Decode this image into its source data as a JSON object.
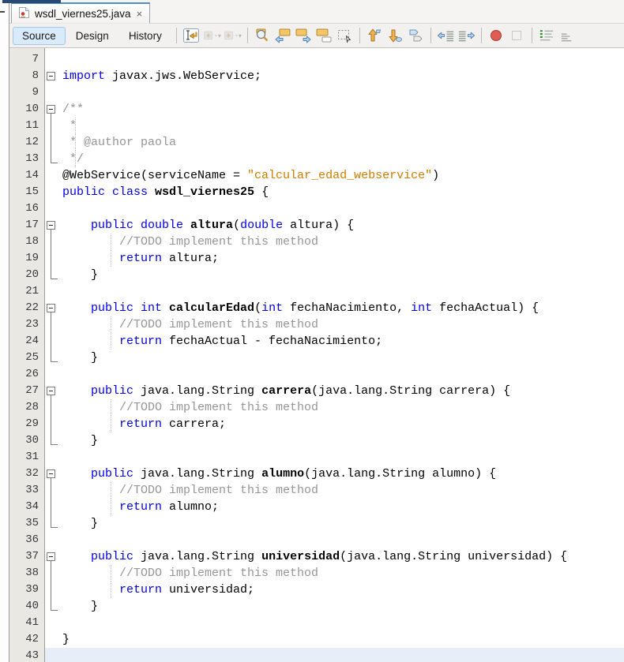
{
  "tab_bar": {
    "active_tab": {
      "label": "wsdl_viernes25.java",
      "close_label": "×",
      "icon": "java-file-icon"
    }
  },
  "toolbar": {
    "view_buttons": [
      {
        "label": "Source",
        "active": true
      },
      {
        "label": "Design",
        "active": false
      },
      {
        "label": "History",
        "active": false
      }
    ],
    "icon_groups": [
      [
        {
          "name": "last-edit-icon"
        },
        {
          "name": "back-icon",
          "disabled": true,
          "dropdown": true
        },
        {
          "name": "forward-icon",
          "disabled": true,
          "dropdown": true
        }
      ],
      [
        {
          "name": "find-selection-icon"
        },
        {
          "name": "find-previous-icon"
        },
        {
          "name": "find-next-icon"
        },
        {
          "name": "toggle-highlight-icon"
        },
        {
          "name": "rect-selection-icon"
        }
      ],
      [
        {
          "name": "previous-bookmark-icon"
        },
        {
          "name": "next-bookmark-icon"
        },
        {
          "name": "toggle-bookmark-icon"
        }
      ],
      [
        {
          "name": "shift-left-icon"
        },
        {
          "name": "shift-right-icon"
        }
      ],
      [
        {
          "name": "start-macro-icon"
        },
        {
          "name": "stop-macro-icon",
          "disabled": true
        }
      ],
      [
        {
          "name": "comment-icon"
        },
        {
          "name": "uncomment-icon"
        }
      ]
    ]
  },
  "editor": {
    "current_line": 43,
    "colors": {
      "keyword": "#0000e6",
      "string": "#ce7b00",
      "comment": "#969696",
      "plain": "#000000",
      "current_line_bg": "#e7eef8",
      "gutter_bg": "#e9e8e3"
    },
    "lines": [
      {
        "n": 7,
        "f": null,
        "g": null,
        "t": []
      },
      {
        "n": 8,
        "f": "single",
        "g": null,
        "t": [
          {
            "s": "k",
            "v": "import"
          },
          {
            "s": "p",
            "v": " javax.jws.WebService;"
          }
        ]
      },
      {
        "n": 9,
        "f": null,
        "g": null,
        "t": []
      },
      {
        "n": 10,
        "f": "start",
        "g": null,
        "t": [
          {
            "s": "c",
            "v": "/**"
          }
        ]
      },
      {
        "n": 11,
        "f": "mid",
        "g": 2,
        "t": [
          {
            "s": "c",
            "v": " *"
          }
        ]
      },
      {
        "n": 12,
        "f": "mid",
        "g": 2,
        "t": [
          {
            "s": "c",
            "v": " * @author paola"
          }
        ]
      },
      {
        "n": 13,
        "f": "end",
        "g": 2,
        "t": [
          {
            "s": "c",
            "v": " */"
          }
        ]
      },
      {
        "n": 14,
        "f": null,
        "g": null,
        "t": [
          {
            "s": "p",
            "v": "@WebService(serviceName = "
          },
          {
            "s": "s",
            "v": "\"calcular_edad_webservice\""
          },
          {
            "s": "p",
            "v": ")"
          }
        ]
      },
      {
        "n": 15,
        "f": null,
        "g": null,
        "t": [
          {
            "s": "k",
            "v": "public class"
          },
          {
            "s": "m",
            "v": " wsdl_viernes25"
          },
          {
            "s": "p",
            "v": " {"
          }
        ]
      },
      {
        "n": 16,
        "f": null,
        "g": null,
        "t": []
      },
      {
        "n": 17,
        "f": "start",
        "g": null,
        "t": [
          {
            "s": "p",
            "v": "    "
          },
          {
            "s": "k",
            "v": "public double"
          },
          {
            "s": "m",
            "v": " altura"
          },
          {
            "s": "p",
            "v": "("
          },
          {
            "s": "k",
            "v": "double"
          },
          {
            "s": "p",
            "v": " altura) {"
          }
        ]
      },
      {
        "n": 18,
        "f": "mid",
        "g": 7,
        "t": [
          {
            "s": "p",
            "v": "        "
          },
          {
            "s": "c",
            "v": "//TODO implement this method"
          }
        ]
      },
      {
        "n": 19,
        "f": "mid",
        "g": 7,
        "t": [
          {
            "s": "p",
            "v": "        "
          },
          {
            "s": "k",
            "v": "return"
          },
          {
            "s": "p",
            "v": " altura;"
          }
        ]
      },
      {
        "n": 20,
        "f": "end",
        "g": null,
        "t": [
          {
            "s": "p",
            "v": "    }"
          }
        ]
      },
      {
        "n": 21,
        "f": null,
        "g": null,
        "t": []
      },
      {
        "n": 22,
        "f": "start",
        "g": null,
        "t": [
          {
            "s": "p",
            "v": "    "
          },
          {
            "s": "k",
            "v": "public int"
          },
          {
            "s": "m",
            "v": " calcularEdad"
          },
          {
            "s": "p",
            "v": "("
          },
          {
            "s": "k",
            "v": "int"
          },
          {
            "s": "p",
            "v": " fechaNacimiento, "
          },
          {
            "s": "k",
            "v": "int"
          },
          {
            "s": "p",
            "v": " fechaActual) {"
          }
        ]
      },
      {
        "n": 23,
        "f": "mid",
        "g": 7,
        "t": [
          {
            "s": "p",
            "v": "        "
          },
          {
            "s": "c",
            "v": "//TODO implement this method"
          }
        ]
      },
      {
        "n": 24,
        "f": "mid",
        "g": 7,
        "t": [
          {
            "s": "p",
            "v": "        "
          },
          {
            "s": "k",
            "v": "return"
          },
          {
            "s": "p",
            "v": " fechaActual - fechaNacimiento;"
          }
        ]
      },
      {
        "n": 25,
        "f": "end",
        "g": null,
        "t": [
          {
            "s": "p",
            "v": "    }"
          }
        ]
      },
      {
        "n": 26,
        "f": null,
        "g": null,
        "t": []
      },
      {
        "n": 27,
        "f": "start",
        "g": null,
        "t": [
          {
            "s": "p",
            "v": "    "
          },
          {
            "s": "k",
            "v": "public"
          },
          {
            "s": "p",
            "v": " java.lang.String"
          },
          {
            "s": "m",
            "v": " carrera"
          },
          {
            "s": "p",
            "v": "(java.lang.String carrera) {"
          }
        ]
      },
      {
        "n": 28,
        "f": "mid",
        "g": 7,
        "t": [
          {
            "s": "p",
            "v": "        "
          },
          {
            "s": "c",
            "v": "//TODO implement this method"
          }
        ]
      },
      {
        "n": 29,
        "f": "mid",
        "g": 7,
        "t": [
          {
            "s": "p",
            "v": "        "
          },
          {
            "s": "k",
            "v": "return"
          },
          {
            "s": "p",
            "v": " carrera;"
          }
        ]
      },
      {
        "n": 30,
        "f": "end",
        "g": null,
        "t": [
          {
            "s": "p",
            "v": "    }"
          }
        ]
      },
      {
        "n": 31,
        "f": null,
        "g": null,
        "t": []
      },
      {
        "n": 32,
        "f": "start",
        "g": null,
        "t": [
          {
            "s": "p",
            "v": "    "
          },
          {
            "s": "k",
            "v": "public"
          },
          {
            "s": "p",
            "v": " java.lang.String"
          },
          {
            "s": "m",
            "v": " alumno"
          },
          {
            "s": "p",
            "v": "(java.lang.String alumno) {"
          }
        ]
      },
      {
        "n": 33,
        "f": "mid",
        "g": 7,
        "t": [
          {
            "s": "p",
            "v": "        "
          },
          {
            "s": "c",
            "v": "//TODO implement this method"
          }
        ]
      },
      {
        "n": 34,
        "f": "mid",
        "g": 7,
        "t": [
          {
            "s": "p",
            "v": "        "
          },
          {
            "s": "k",
            "v": "return"
          },
          {
            "s": "p",
            "v": " alumno;"
          }
        ]
      },
      {
        "n": 35,
        "f": "end",
        "g": null,
        "t": [
          {
            "s": "p",
            "v": "    }"
          }
        ]
      },
      {
        "n": 36,
        "f": null,
        "g": null,
        "t": []
      },
      {
        "n": 37,
        "f": "start",
        "g": null,
        "t": [
          {
            "s": "p",
            "v": "    "
          },
          {
            "s": "k",
            "v": "public"
          },
          {
            "s": "p",
            "v": " java.lang.String"
          },
          {
            "s": "m",
            "v": " universidad"
          },
          {
            "s": "p",
            "v": "(java.lang.String universidad) {"
          }
        ]
      },
      {
        "n": 38,
        "f": "mid",
        "g": 7,
        "t": [
          {
            "s": "p",
            "v": "        "
          },
          {
            "s": "c",
            "v": "//TODO implement this method"
          }
        ]
      },
      {
        "n": 39,
        "f": "mid",
        "g": 7,
        "t": [
          {
            "s": "p",
            "v": "        "
          },
          {
            "s": "k",
            "v": "return"
          },
          {
            "s": "p",
            "v": " universidad;"
          }
        ]
      },
      {
        "n": 40,
        "f": "end",
        "g": null,
        "t": [
          {
            "s": "p",
            "v": "    }"
          }
        ]
      },
      {
        "n": 41,
        "f": null,
        "g": null,
        "t": []
      },
      {
        "n": 42,
        "f": null,
        "g": null,
        "t": [
          {
            "s": "p",
            "v": "}"
          }
        ]
      },
      {
        "n": 43,
        "f": null,
        "g": null,
        "t": []
      }
    ]
  }
}
